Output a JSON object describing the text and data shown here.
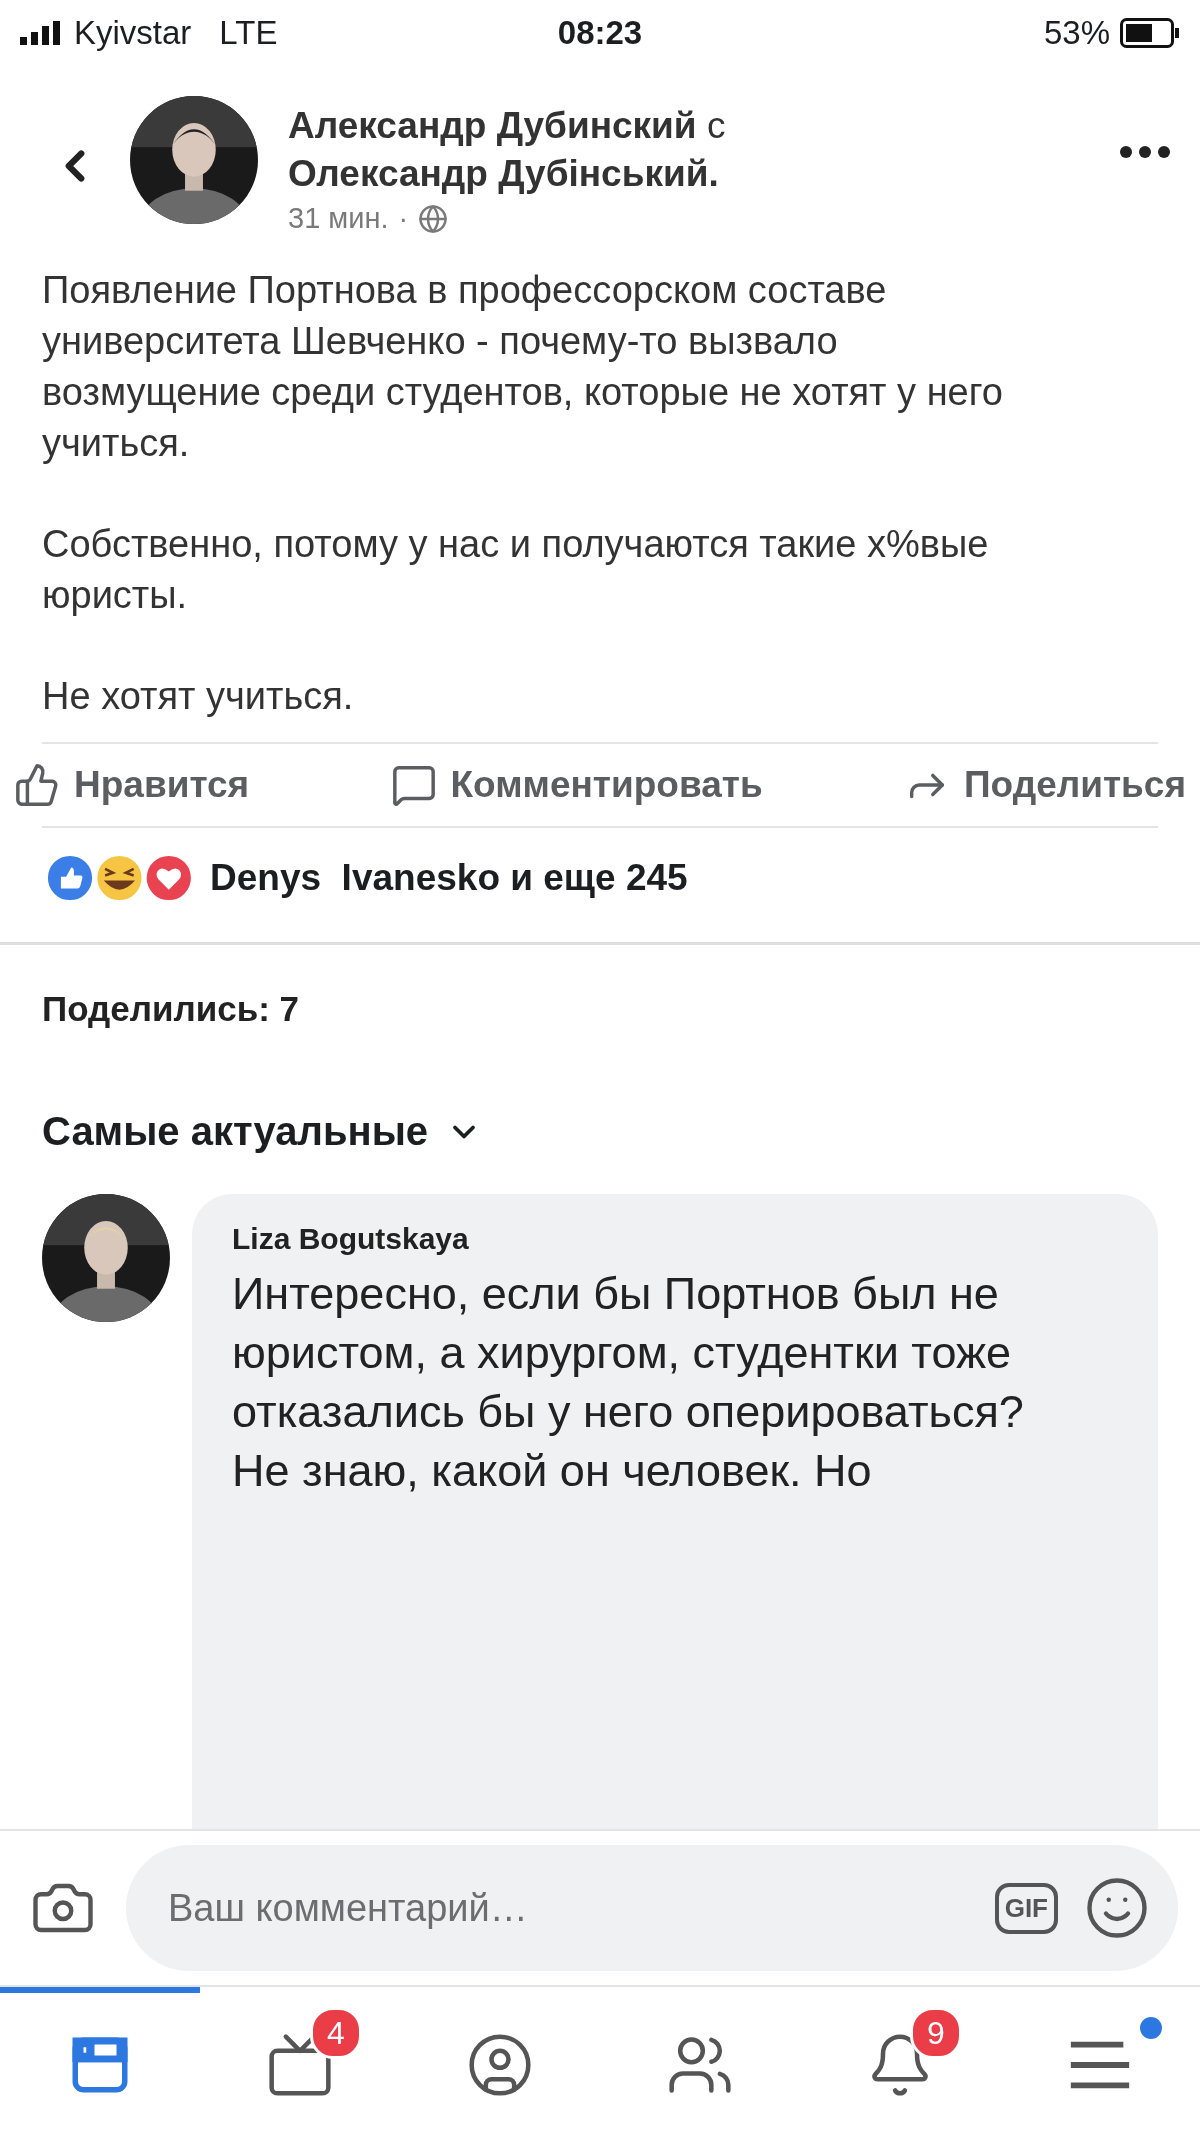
{
  "status_bar": {
    "carrier": "Kyivstar",
    "network": "LTE",
    "time": "08:23",
    "battery": "53%"
  },
  "post": {
    "author": "Александр Дубинский",
    "connector": "с",
    "tagged": "Олександр Дубінський.",
    "time": "31 мин.",
    "separator": "·",
    "paragraphs": [
      "Появление Портнова в профессорском составе университета Шевченко - почему-то вызвало возмущение среди студентов, которые не хотят у него учиться.",
      "Собственно, потому у нас и получаются такие х%вые юристы.",
      "Не хотят учиться."
    ]
  },
  "actions": [
    {
      "kind": "like",
      "label": "Нравится"
    },
    {
      "kind": "comment",
      "label": "Комментировать"
    },
    {
      "kind": "share",
      "label": "Поделиться"
    }
  ],
  "reactions": {
    "summary": "Denys  Ivanesko и еще 245"
  },
  "shares": "Поделились: 7",
  "sort": {
    "label": "Самые актуальные"
  },
  "comments": [
    {
      "author": "Liza Bogutskaya",
      "text": "Интересно, если бы Портнов был не юристом, а хирургом, студентки тоже отказались бы у него оперироваться?\nНе знаю, какой он человек. Но"
    }
  ],
  "composer": {
    "placeholder": "Ваш комментарий…",
    "gif": "GIF"
  },
  "nav": [
    {
      "kind": "feed",
      "selected": true
    },
    {
      "kind": "watch",
      "selected": false,
      "badge": "4"
    },
    {
      "kind": "profile",
      "selected": false
    },
    {
      "kind": "groups",
      "selected": false
    },
    {
      "kind": "notifications",
      "selected": false,
      "badge": "9"
    },
    {
      "kind": "menu",
      "selected": false,
      "dot": true
    }
  ]
}
